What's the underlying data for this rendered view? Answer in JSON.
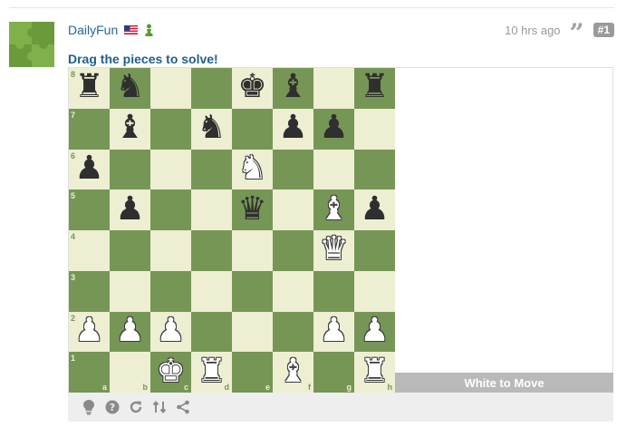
{
  "post": {
    "username": "DailyFun",
    "time": "10 hrs ago",
    "post_number": "#1",
    "instruction": "Drag the pieces to solve!"
  },
  "puzzle": {
    "turn_text": "White to Move",
    "rank_labels": [
      "8",
      "7",
      "6",
      "5",
      "4",
      "3",
      "2",
      "1"
    ],
    "file_labels": [
      "a",
      "b",
      "c",
      "d",
      "e",
      "f",
      "g",
      "h"
    ],
    "board": [
      [
        "b:r",
        "b:n",
        "",
        "",
        "b:k",
        "b:b",
        "",
        "b:r"
      ],
      [
        "",
        "b:b",
        "",
        "b:n",
        "",
        "b:p",
        "b:p",
        ""
      ],
      [
        "b:p",
        "",
        "",
        "",
        "w:n",
        "",
        "",
        ""
      ],
      [
        "",
        "b:p",
        "",
        "",
        "b:q",
        "",
        "w:b",
        "b:p"
      ],
      [
        "",
        "",
        "",
        "",
        "",
        "",
        "w:q",
        ""
      ],
      [
        "",
        "",
        "",
        "",
        "",
        "",
        "",
        ""
      ],
      [
        "w:p",
        "w:p",
        "w:p",
        "",
        "",
        "",
        "w:p",
        "w:p"
      ],
      [
        "",
        "",
        "w:k",
        "w:r",
        "",
        "w:b",
        "",
        "w:r"
      ]
    ]
  },
  "toolbar": {
    "icons": [
      "lightbulb-icon",
      "help-icon",
      "retry-icon",
      "flip-board-icon",
      "share-icon"
    ]
  },
  "colors": {
    "light_square": "#eeeed2",
    "dark_square": "#769656",
    "link": "#2a6496",
    "turn_bar": "#b9b9b9"
  }
}
